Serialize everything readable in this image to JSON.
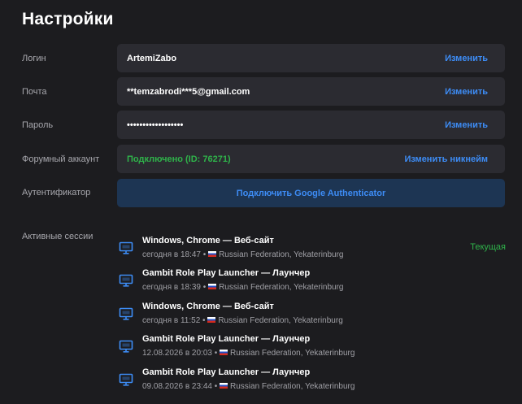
{
  "page": {
    "title": "Настройки"
  },
  "rows": {
    "login": {
      "label": "Логин",
      "value": "ArtemiZabo",
      "action": "Изменить"
    },
    "email": {
      "label": "Почта",
      "value": "**temzabrodi***5@gmail.com",
      "action": "Изменить"
    },
    "password": {
      "label": "Пароль",
      "value": "••••••••••••••••••",
      "action": "Изменить"
    },
    "forum": {
      "label": "Форумный аккаунт",
      "value": "Подключено (ID: 76271)",
      "action": "Изменить никнейм"
    },
    "auth": {
      "label": "Аутентификатор",
      "action": "Подключить Google Authenticator"
    }
  },
  "sessions": {
    "label": "Активные сессии",
    "current_label": "Текущая",
    "items": [
      {
        "title": "Windows, Chrome — Веб-сайт",
        "time": "сегодня в 18:47",
        "location": "Russian Federation, Yekaterinburg"
      },
      {
        "title": "Gambit Role Play Launcher — Лаунчер",
        "time": "сегодня в 18:39",
        "location": "Russian Federation, Yekaterinburg"
      },
      {
        "title": "Windows, Chrome — Веб-сайт",
        "time": "сегодня в 11:52",
        "location": "Russian Federation, Yekaterinburg"
      },
      {
        "title": "Gambit Role Play Launcher — Лаунчер",
        "time": "12.08.2026 в 20:03",
        "location": "Russian Federation, Yekaterinburg"
      },
      {
        "title": "Gambit Role Play Launcher — Лаунчер",
        "time": "09.08.2026 в 23:44",
        "location": "Russian Federation, Yekaterinburg"
      }
    ]
  },
  "colors": {
    "background": "#1c1c1f",
    "field": "#2b2b31",
    "accent": "#3d8cf5",
    "success": "#2fb34a",
    "auth_button": "#1d3553"
  }
}
